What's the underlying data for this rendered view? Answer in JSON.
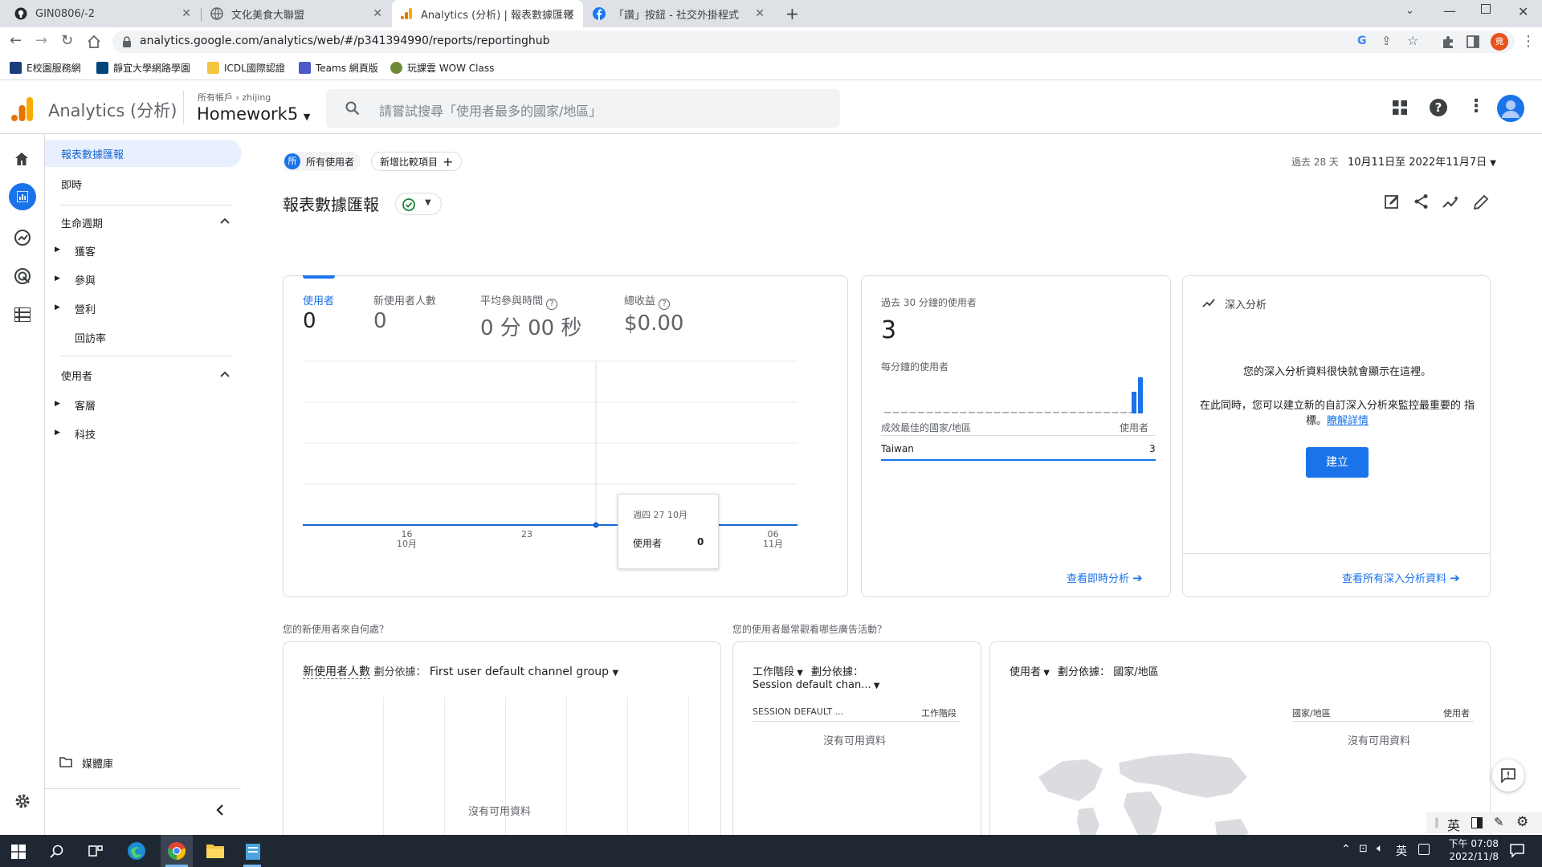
{
  "browser": {
    "tabs": [
      {
        "title": "GIN0806/-2",
        "icon": "github-icon",
        "active": false
      },
      {
        "title": "文化美食大聯盟",
        "icon": "globe-icon",
        "active": false
      },
      {
        "title": "Analytics (分析) | 報表數據匯報",
        "icon": "analytics-icon",
        "active": true
      },
      {
        "title": "「讚」按鈕 - 社交外掛程式",
        "icon": "facebook-icon",
        "active": false
      }
    ],
    "url": "analytics.google.com/analytics/web/#/p341394990/reports/reportinghub",
    "profile_letter": "竟",
    "bookmarks": [
      "E校園服務網",
      "靜宜大學網路學園",
      "ICDL國際認證",
      "Teams 網頁版",
      "玩課雲 WOW Class"
    ]
  },
  "ga_header": {
    "brand": "Analytics (分析)",
    "breadcrumb_root": "所有帳戶",
    "breadcrumb_account": "zhijing",
    "property": "Homework5",
    "search_placeholder": "請嘗試搜尋「使用者最多的國家/地區」"
  },
  "sidenav": {
    "item_reports": "報表數據匯報",
    "item_realtime": "即時",
    "section_lifecycle": "生命週期",
    "lifecycle_items": [
      "獲客",
      "參與",
      "營利",
      "回訪率"
    ],
    "section_users": "使用者",
    "user_items": [
      "客層",
      "科技"
    ],
    "library": "媒體庫"
  },
  "main": {
    "segment_badge": "所",
    "segment_label": "所有使用者",
    "add_comparison": "新增比較項目",
    "date_prefix": "過去 28 天",
    "date_range": "10月11日至 2022年11月7日",
    "page_title": "報表數據匯報",
    "metrics": [
      {
        "label": "使用者",
        "value": "0"
      },
      {
        "label": "新使用者人數",
        "value": "0"
      },
      {
        "label": "平均參與時間",
        "value": "0 分 00 秒"
      },
      {
        "label": "總收益",
        "value": "$0.00"
      }
    ],
    "chart_ticks": [
      {
        "top": "16",
        "bottom": "10月"
      },
      {
        "top": "23",
        "bottom": ""
      },
      {
        "top": "06",
        "bottom": "11月"
      }
    ],
    "tooltip_date": "週四 27 10月",
    "tooltip_label": "使用者",
    "tooltip_value": "0",
    "realtime": {
      "title": "過去 30 分鐘的使用者",
      "value": "3",
      "per_minute": "每分鐘的使用者",
      "col_country": "成效最佳的國家/地區",
      "col_users": "使用者",
      "row_country": "Taiwan",
      "row_value": "3",
      "link": "查看即時分析"
    },
    "insights": {
      "title": "深入分析",
      "text1": "您的深入分析資料很快就會顯示在這裡。",
      "text2": "在此同時，您可以建立新的自訂深入分析來監控最重要的 指標。",
      "learn_more": "瞭解詳情",
      "create": "建立",
      "link": "查看所有深入分析資料"
    },
    "q1": "您的新使用者來自何處？",
    "q2": "您的使用者最常觀看哪些廣告活動？",
    "new_users_metric": "新使用者人數",
    "split_by": "劃分依據：",
    "first_user_dim": "First user default channel group",
    "no_data": "沒有可用資料",
    "sessions_metric": "工作階段",
    "session_dim": "Session default chan...",
    "session_col": "SESSION DEFAULT ...",
    "session_col2": "工作階段",
    "geo_metric": "使用者",
    "geo_dim": "國家/地區",
    "geo_col1": "國家/地區",
    "geo_col2": "使用者"
  },
  "taskbar": {
    "ime": "英",
    "ime2": "英",
    "time": "下午 07:08",
    "date": "2022/11/8"
  },
  "colors": {
    "ga_orange": "#f9ab00",
    "ga_orange_dark": "#e37400",
    "blue": "#1a73e8",
    "chart_line": "#1967d2"
  }
}
